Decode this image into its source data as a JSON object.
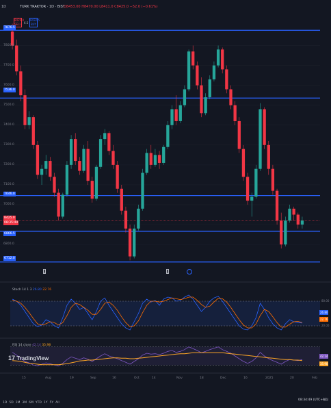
{
  "header": {
    "interval": "1D",
    "symbol_title": "TURK TRAKTOR · 1D · BIST",
    "ohlc": "O8453.00 H8470.00 L8411.0 C8425.0 −52.0 (−0.61%)",
    "mini_sell": {
      "price": "8426.0",
      "label": "SELL"
    },
    "mini_buy": {
      "price": "8432.5",
      "label": "BUY"
    },
    "spread": "6.5"
  },
  "price_axis": {
    "labels": [
      "7800.0",
      "7700.0",
      "7600.0",
      "7500.0",
      "7400.0",
      "7300.0",
      "7200.0",
      "7100.0",
      "7000.0",
      "6900.0",
      "6800.0"
    ],
    "tags": [
      {
        "text": "7876.5",
        "color": "#2962ff"
      },
      {
        "text": "7536.0",
        "color": "#2962ff"
      },
      {
        "text": "7046.0",
        "color": "#2962ff"
      },
      {
        "text": "8425.0",
        "color": "#f23645"
      },
      {
        "text": "08:35:49",
        "color": "#f23645"
      },
      {
        "text": "6866.5",
        "color": "#2962ff"
      },
      {
        "text": "6712.0",
        "color": "#2962ff"
      }
    ]
  },
  "candles": [
    [
      7870,
      7910,
      7780,
      7800
    ],
    [
      7800,
      7830,
      7650,
      7670
    ],
    [
      7670,
      7700,
      7520,
      7550
    ],
    [
      7550,
      7580,
      7380,
      7400
    ],
    [
      7400,
      7470,
      7380,
      7440
    ],
    [
      7440,
      7450,
      7280,
      7300
    ],
    [
      7300,
      7320,
      7130,
      7150
    ],
    [
      7150,
      7200,
      7100,
      7180
    ],
    [
      7180,
      7250,
      7150,
      7220
    ],
    [
      7220,
      7240,
      7120,
      7140
    ],
    [
      7140,
      7160,
      7040,
      7060
    ],
    [
      7060,
      7080,
      6920,
      6940
    ],
    [
      6940,
      7060,
      6930,
      7050
    ],
    [
      7050,
      7220,
      7040,
      7200
    ],
    [
      7200,
      7350,
      7180,
      7330
    ],
    [
      7330,
      7360,
      7200,
      7220
    ],
    [
      7220,
      7240,
      7150,
      7170
    ],
    [
      7170,
      7300,
      7160,
      7280
    ],
    [
      7280,
      7320,
      7100,
      7120
    ],
    [
      7120,
      7140,
      7010,
      7030
    ],
    [
      7030,
      7200,
      7020,
      7190
    ],
    [
      7190,
      7350,
      7180,
      7330
    ],
    [
      7330,
      7380,
      7300,
      7360
    ],
    [
      7360,
      7370,
      7250,
      7270
    ],
    [
      7270,
      7300,
      7180,
      7200
    ],
    [
      7200,
      7220,
      7060,
      7080
    ],
    [
      7080,
      7100,
      6950,
      6970
    ],
    [
      6970,
      6990,
      6860,
      6880
    ],
    [
      6880,
      6900,
      6720,
      6740
    ],
    [
      6740,
      6900,
      6730,
      6880
    ],
    [
      6880,
      7000,
      6870,
      6980
    ],
    [
      6980,
      7180,
      6970,
      7160
    ],
    [
      7160,
      7280,
      7150,
      7260
    ],
    [
      7260,
      7300,
      7180,
      7200
    ],
    [
      7200,
      7280,
      7190,
      7250
    ],
    [
      7250,
      7270,
      7180,
      7210
    ],
    [
      7210,
      7300,
      7200,
      7290
    ],
    [
      7290,
      7420,
      7280,
      7400
    ],
    [
      7400,
      7500,
      7380,
      7480
    ],
    [
      7480,
      7550,
      7400,
      7420
    ],
    [
      7420,
      7520,
      7410,
      7500
    ],
    [
      7500,
      7600,
      7490,
      7580
    ],
    [
      7580,
      7780,
      7570,
      7770
    ],
    [
      7770,
      7800,
      7680,
      7700
    ],
    [
      7700,
      7720,
      7580,
      7600
    ],
    [
      7600,
      7640,
      7440,
      7460
    ],
    [
      7460,
      7560,
      7450,
      7540
    ],
    [
      7540,
      7650,
      7530,
      7630
    ],
    [
      7630,
      7720,
      7620,
      7700
    ],
    [
      7700,
      7800,
      7690,
      7780
    ],
    [
      7780,
      7790,
      7660,
      7680
    ],
    [
      7680,
      7700,
      7560,
      7580
    ],
    [
      7580,
      7600,
      7480,
      7500
    ],
    [
      7500,
      7520,
      7400,
      7420
    ],
    [
      7420,
      7440,
      7260,
      7280
    ],
    [
      7280,
      7300,
      7120,
      7140
    ],
    [
      7140,
      7160,
      7000,
      7020
    ],
    [
      7020,
      7060,
      6940,
      7040
    ],
    [
      7040,
      7200,
      7030,
      7180
    ],
    [
      7180,
      7510,
      7170,
      7480
    ],
    [
      7480,
      7490,
      7280,
      7300
    ],
    [
      7300,
      7320,
      7150,
      7180
    ],
    [
      7180,
      7200,
      7050,
      7070
    ],
    [
      7070,
      7080,
      6900,
      6920
    ],
    [
      6920,
      6960,
      6780,
      6800
    ],
    [
      6800,
      6940,
      6790,
      6920
    ],
    [
      6920,
      7000,
      6910,
      6980
    ],
    [
      6980,
      6990,
      6920,
      6950
    ],
    [
      6950,
      6960,
      6880,
      6900
    ],
    [
      6900,
      6940,
      6880,
      6920
    ]
  ],
  "stoch": {
    "legend": "Stoch 14 1 3",
    "k_value": "26.80",
    "d_value": "22.76",
    "axis_labels": [
      "80.00",
      "20.00"
    ],
    "right_tags": [
      {
        "text": "26.80",
        "color": "#2962ff"
      },
      {
        "text": "22.76",
        "color": "#ff6d00"
      }
    ],
    "k": [
      85,
      80,
      70,
      55,
      40,
      25,
      18,
      22,
      35,
      30,
      20,
      15,
      40,
      70,
      85,
      75,
      60,
      65,
      50,
      35,
      55,
      80,
      88,
      70,
      55,
      40,
      25,
      15,
      10,
      30,
      50,
      75,
      85,
      78,
      82,
      70,
      85,
      90,
      88,
      80,
      82,
      90,
      95,
      85,
      70,
      55,
      65,
      80,
      88,
      92,
      80,
      65,
      50,
      35,
      20,
      12,
      10,
      20,
      40,
      75,
      60,
      40,
      25,
      15,
      10,
      25,
      35,
      30,
      28,
      27
    ],
    "d": [
      82,
      80,
      75,
      65,
      52,
      38,
      25,
      22,
      25,
      30,
      28,
      22,
      28,
      45,
      65,
      75,
      72,
      65,
      58,
      48,
      48,
      60,
      75,
      78,
      70,
      58,
      42,
      28,
      18,
      20,
      32,
      52,
      70,
      80,
      80,
      78,
      80,
      84,
      88,
      86,
      84,
      86,
      90,
      90,
      82,
      72,
      65,
      68,
      78,
      87,
      86,
      78,
      65,
      50,
      35,
      22,
      15,
      15,
      25,
      45,
      60,
      55,
      42,
      28,
      17,
      17,
      24,
      30,
      31,
      28
    ]
  },
  "rsi": {
    "legend": "RSI 14 close",
    "value": "42.14",
    "ma_value": "35.98",
    "right_tags": [
      {
        "text": "42.14",
        "color": "#7e57c2"
      },
      {
        "text": "35.98",
        "color": "#ffa726"
      }
    ],
    "line": [
      58,
      52,
      45,
      38,
      35,
      30,
      28,
      32,
      35,
      33,
      30,
      28,
      34,
      42,
      48,
      45,
      42,
      46,
      43,
      38,
      44,
      50,
      55,
      50,
      47,
      44,
      40,
      36,
      32,
      38,
      44,
      52,
      56,
      54,
      55,
      53,
      56,
      60,
      62,
      58,
      60,
      64,
      70,
      66,
      62,
      57,
      60,
      64,
      67,
      70,
      64,
      60,
      56,
      50,
      44,
      38,
      34,
      38,
      46,
      58,
      50,
      44,
      40,
      36,
      32,
      38,
      42,
      41,
      40,
      42
    ],
    "ma": [
      40,
      39,
      38,
      36,
      34,
      33,
      32,
      31,
      31,
      31,
      31,
      31,
      32,
      33,
      35,
      37,
      39,
      40,
      41,
      41,
      42,
      43,
      44,
      45,
      46,
      46,
      45,
      45,
      44,
      44,
      45,
      46,
      47,
      48,
      49,
      50,
      51,
      52,
      53,
      54,
      55,
      55,
      56,
      57,
      57,
      57,
      57,
      57,
      57,
      57,
      57,
      56,
      55,
      54,
      53,
      52,
      51,
      50,
      49,
      48,
      47,
      46,
      45,
      44,
      43,
      42,
      42,
      41,
      41,
      40
    ]
  },
  "x_axis": [
    "15",
    "Aug",
    "19",
    "Sep",
    "16",
    "Oct",
    "14",
    "Nov",
    "18",
    "Dec",
    "16",
    "2025",
    "20",
    "Feb"
  ],
  "markers": [
    "E",
    "D"
  ],
  "tv_logo": "TradingView",
  "bottombar": {
    "ranges": [
      "1D",
      "5D",
      "1M",
      "3M",
      "6M",
      "YTD",
      "1Y",
      "5Y",
      "All"
    ],
    "time": "08:34:49 (UTC+3)",
    "adj": "ADJ"
  }
}
